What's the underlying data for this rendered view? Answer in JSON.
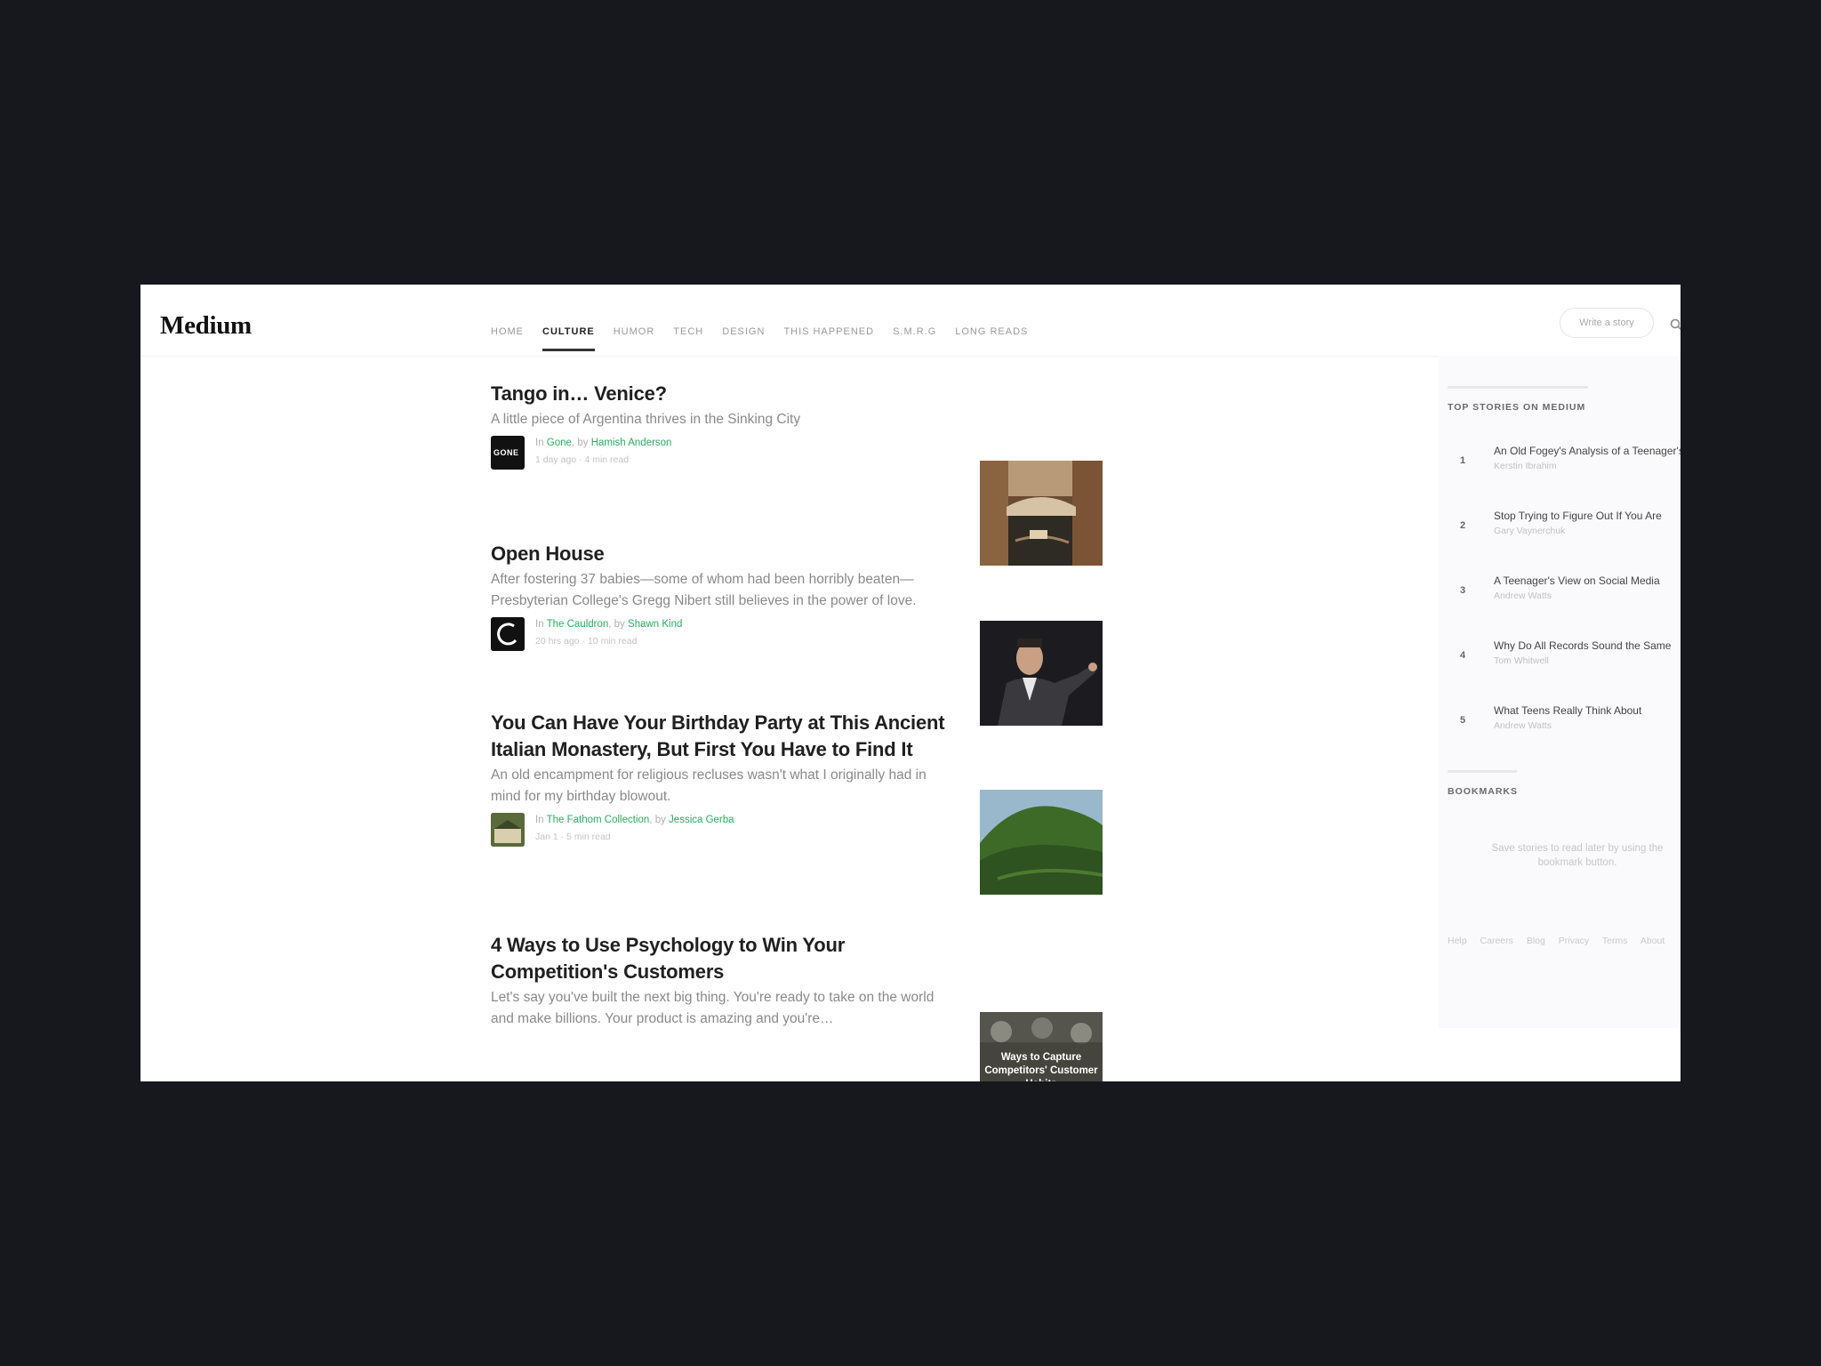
{
  "header": {
    "logo": "Medium",
    "nav": [
      "HOME",
      "CULTURE",
      "HUMOR",
      "TECH",
      "DESIGN",
      "THIS HAPPENED",
      "S.M.R.G",
      "LONG READS"
    ],
    "active_nav": "CULTURE",
    "write_label": "Write a story"
  },
  "stories": [
    {
      "title": "Tango in… Venice?",
      "subtitle": "A little piece of Argentina thrives in the Sinking City",
      "publication": "Gone",
      "author": "Hamish Anderson",
      "age": "1 day ago",
      "read_time": "4 min read",
      "avatar_text": "GONE"
    },
    {
      "title": "Open House",
      "subtitle": "After fostering 37 babies—some of whom had been horribly beaten—Presbyterian College's Gregg Nibert still believes in the power of love.",
      "publication": "The Cauldron",
      "author": "Shawn Kind",
      "age": "20 hrs ago",
      "read_time": "10 min read",
      "avatar_text": ""
    },
    {
      "title": "You Can Have Your Birthday Party at This Ancient Italian Monastery, But First You Have to Find It",
      "subtitle": "An old encampment for religious recluses wasn't what I originally had in mind for my birthday blowout.",
      "publication": "The Fathom Collection",
      "author": "Jessica Gerba",
      "age": "Jan 1",
      "read_time": "5 min read",
      "avatar_text": ""
    },
    {
      "title": "4 Ways to Use Psychology to Win Your Competition's Customers",
      "subtitle": "Let's say you've built the next big thing. You're ready to take on the world and make billions. Your product is amazing and you're…",
      "thumb_caption": "Ways to Capture Competitors' Customer Habits"
    }
  ],
  "meta_words": {
    "in": "In",
    "by": "by"
  },
  "sidebar": {
    "top_heading": "TOP STORIES ON MEDIUM",
    "top_stories": [
      {
        "num": "1",
        "title": "An Old Fogey's Analysis of a Teenager's View",
        "author": "Kerstin Ibrahim"
      },
      {
        "num": "2",
        "title": "Stop Trying to Figure Out If You Are",
        "author": "Gary Vaynerchuk"
      },
      {
        "num": "3",
        "title": "A Teenager's View on Social Media",
        "author": "Andrew Watts"
      },
      {
        "num": "4",
        "title": "Why Do All Records Sound the Same",
        "author": "Tom Whitwell"
      },
      {
        "num": "5",
        "title": "What Teens Really Think About",
        "author": "Andrew Watts"
      }
    ],
    "bookmarks_heading": "BOOKMARKS",
    "bookmarks_empty": "Save stories to read later by using the bookmark button.",
    "footer": [
      "Help",
      "Careers",
      "Blog",
      "Privacy",
      "Terms",
      "About"
    ]
  },
  "colors": {
    "page_bg": "#16181d",
    "accent_green": "#27ae60",
    "sidebar_bg": "#fafafc"
  }
}
